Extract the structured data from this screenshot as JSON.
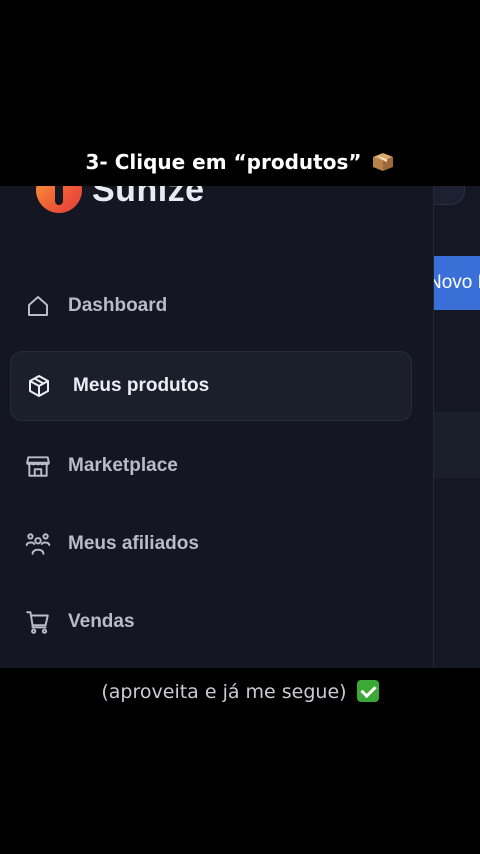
{
  "captions": {
    "top": "3- Clique em “produtos”",
    "bottom": "(aproveita e já me segue)"
  },
  "brand": {
    "name": "Sunize"
  },
  "sidebar": {
    "items": [
      {
        "label": "Dashboard",
        "icon": "home-icon",
        "active": false
      },
      {
        "label": "Meus produtos",
        "icon": "box-icon",
        "active": true
      },
      {
        "label": "Marketplace",
        "icon": "store-icon",
        "active": false
      },
      {
        "label": "Meus afiliados",
        "icon": "users-icon",
        "active": false
      },
      {
        "label": "Vendas",
        "icon": "cart-icon",
        "active": false
      }
    ]
  },
  "main": {
    "new_product_button": "Novo Produto"
  },
  "colors": {
    "background": "#141722",
    "accent": "#3a6fd8",
    "brand_gradient_start": "#f7a23a",
    "brand_gradient_end": "#e23c3c"
  }
}
